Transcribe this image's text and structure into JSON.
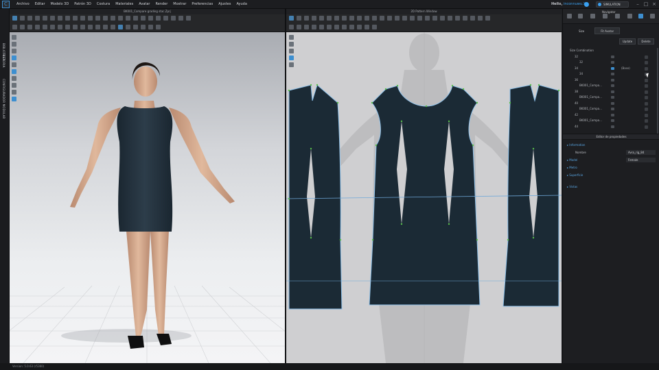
{
  "menu": [
    "Archivo",
    "Editar",
    "Modelo 3D",
    "Patrón 3D",
    "Costura",
    "Materiales",
    "Avatar",
    "Render",
    "Mostrar",
    "Preferencias",
    "Ajustes",
    "Ayuda"
  ],
  "user": {
    "greeting": "Hello,",
    "name": "inconnuwu.X3"
  },
  "simulation_label": "SIMULATION",
  "left_tabs": [
    "BIBLIOTECA",
    "HISTORIA",
    "CONFIGURADOR MODULAR"
  ],
  "view3d": {
    "title": "BK001_Compare grading stac.Zprj"
  },
  "view2d": {
    "title": "2D Pattern Window"
  },
  "navigator": {
    "title": "Navigator",
    "tabs": [
      "Size",
      "Fit Avatar"
    ],
    "update_label": "Update",
    "delete_label": "Delete",
    "tree": [
      {
        "label": "Size Combination",
        "indent": 0
      },
      {
        "label": "32",
        "indent": 1
      },
      {
        "label": "32",
        "indent": 2
      },
      {
        "label": "34",
        "indent": 1,
        "tag": "(Base)",
        "eye": true
      },
      {
        "label": "34",
        "indent": 2
      },
      {
        "label": "36",
        "indent": 1
      },
      {
        "label": "BK001_Compa...",
        "indent": 2
      },
      {
        "label": "38",
        "indent": 1
      },
      {
        "label": "BK001_Compa...",
        "indent": 2
      },
      {
        "label": "40",
        "indent": 1
      },
      {
        "label": "BK001_Compa...",
        "indent": 2
      },
      {
        "label": "42",
        "indent": 1
      },
      {
        "label": "BK001_Compa...",
        "indent": 2
      },
      {
        "label": "44",
        "indent": 1
      }
    ]
  },
  "props": {
    "header": "Editor de propiedades",
    "information": "Information",
    "name_label": "Nombre",
    "name_value": "Avra_rig_84",
    "model_label": "Model",
    "model_value": "Female",
    "sections": [
      "Metro",
      "Superficie",
      "Vistas"
    ]
  },
  "status": "Version: 5.0.63 (r5360)",
  "colors": {
    "garment": "#1b2a35",
    "accent": "#3d8fd0",
    "pattern_outline": "#8fc2ea",
    "notch": "#58c04a"
  }
}
